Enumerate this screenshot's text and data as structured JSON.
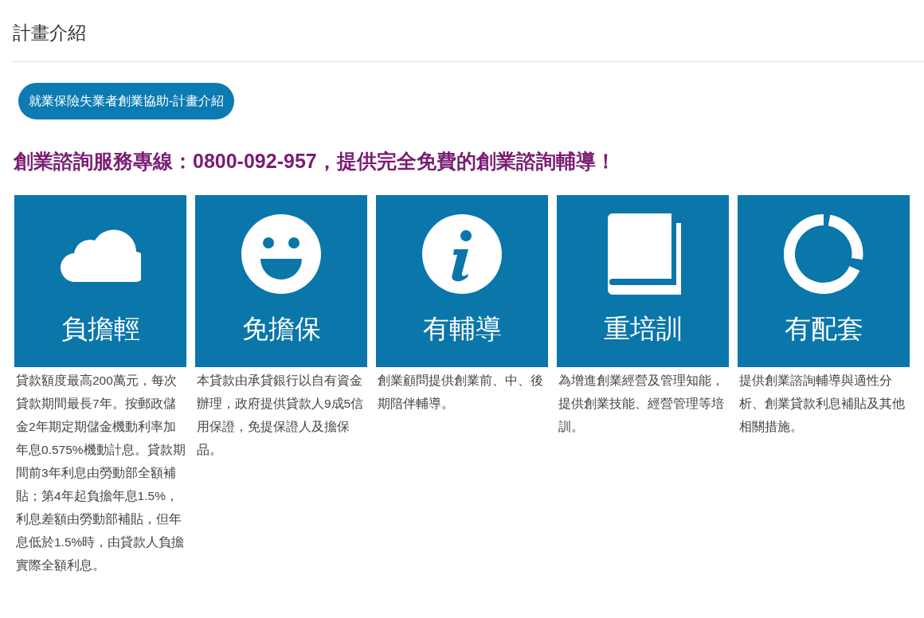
{
  "page_title": "計畫介紹",
  "program_button": "就業保險失業者創業協助-計畫介紹",
  "headline": "創業諮詢服務專線：0800-092-957，提供完全免費的創業諮詢輔導！",
  "cards": [
    {
      "kind": "cloud",
      "label": "負擔輕",
      "description": "貸款額度最高200萬元，每次貸款期間最長7年。按郵政儲金2年期定期儲金機動利率加年息0.575%機動計息。貸款期間前3年利息由勞動部全額補貼；第4年起負擔年息1.5%，利息差額由勞動部補貼，但年息低於1.5%時，由貸款人負擔實際全額利息。"
    },
    {
      "kind": "smiley",
      "label": "免擔保",
      "description": "本貸款由承貸銀行以自有資金辦理，政府提供貸款人9成5信用保證，免提保證人及擔保品。"
    },
    {
      "kind": "info",
      "label": "有輔導",
      "description": "創業顧問提供創業前、中、後期陪伴輔導。"
    },
    {
      "kind": "book",
      "label": "重培訓",
      "description": "為增進創業經營及管理知能，提供創業技能、經營管理等培訓。"
    },
    {
      "kind": "donut",
      "label": "有配套",
      "description": "提供創業諮詢輔導與適性分析、創業貸款利息補貼及其他相關措施。"
    }
  ]
}
